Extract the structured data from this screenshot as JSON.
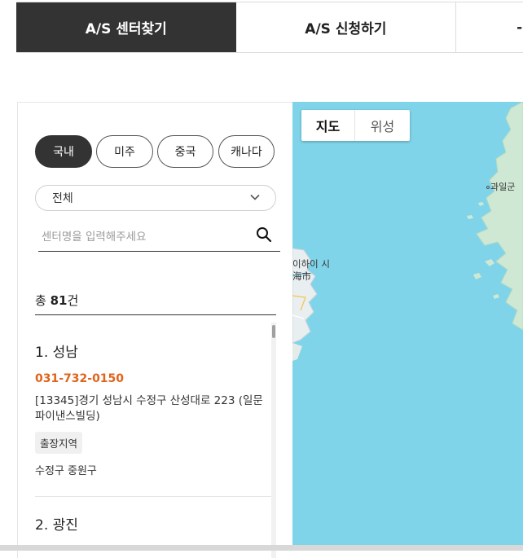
{
  "tabs": [
    {
      "label": "A/S 센터찾기",
      "active": true
    },
    {
      "label": "A/S 신청하기",
      "active": false
    },
    {
      "label": "-",
      "active": false
    }
  ],
  "regions": [
    {
      "label": "국내",
      "active": true
    },
    {
      "label": "미주",
      "active": false
    },
    {
      "label": "중국",
      "active": false
    },
    {
      "label": "캐나다",
      "active": false
    }
  ],
  "filter": {
    "selected": "전체",
    "icon": "chevron-down-icon"
  },
  "search": {
    "placeholder": "센터명을 입력해주세요",
    "value": "",
    "icon": "search-icon"
  },
  "total": {
    "prefix": "총",
    "count": "81",
    "suffix": "건"
  },
  "centers": [
    {
      "title": "1. 성남",
      "phone": "031-732-0150",
      "address": "[13345]경기 성남시 수정구 산성대로 223 (일문파이낸스빌딩)",
      "badge": "출장지역",
      "area": "수정구 중원구"
    },
    {
      "title": "2. 광진"
    }
  ],
  "map": {
    "toggle": {
      "map_label": "지도",
      "satellite_label": "위성"
    },
    "labels": {
      "city": "이하이 시",
      "city_cn": "海市",
      "place": "과일군"
    },
    "colors": {
      "water": "#80d4e9",
      "land": "#cfe8d4"
    }
  },
  "colors": {
    "accent_dark": "#333333",
    "phone": "#e0641a"
  }
}
